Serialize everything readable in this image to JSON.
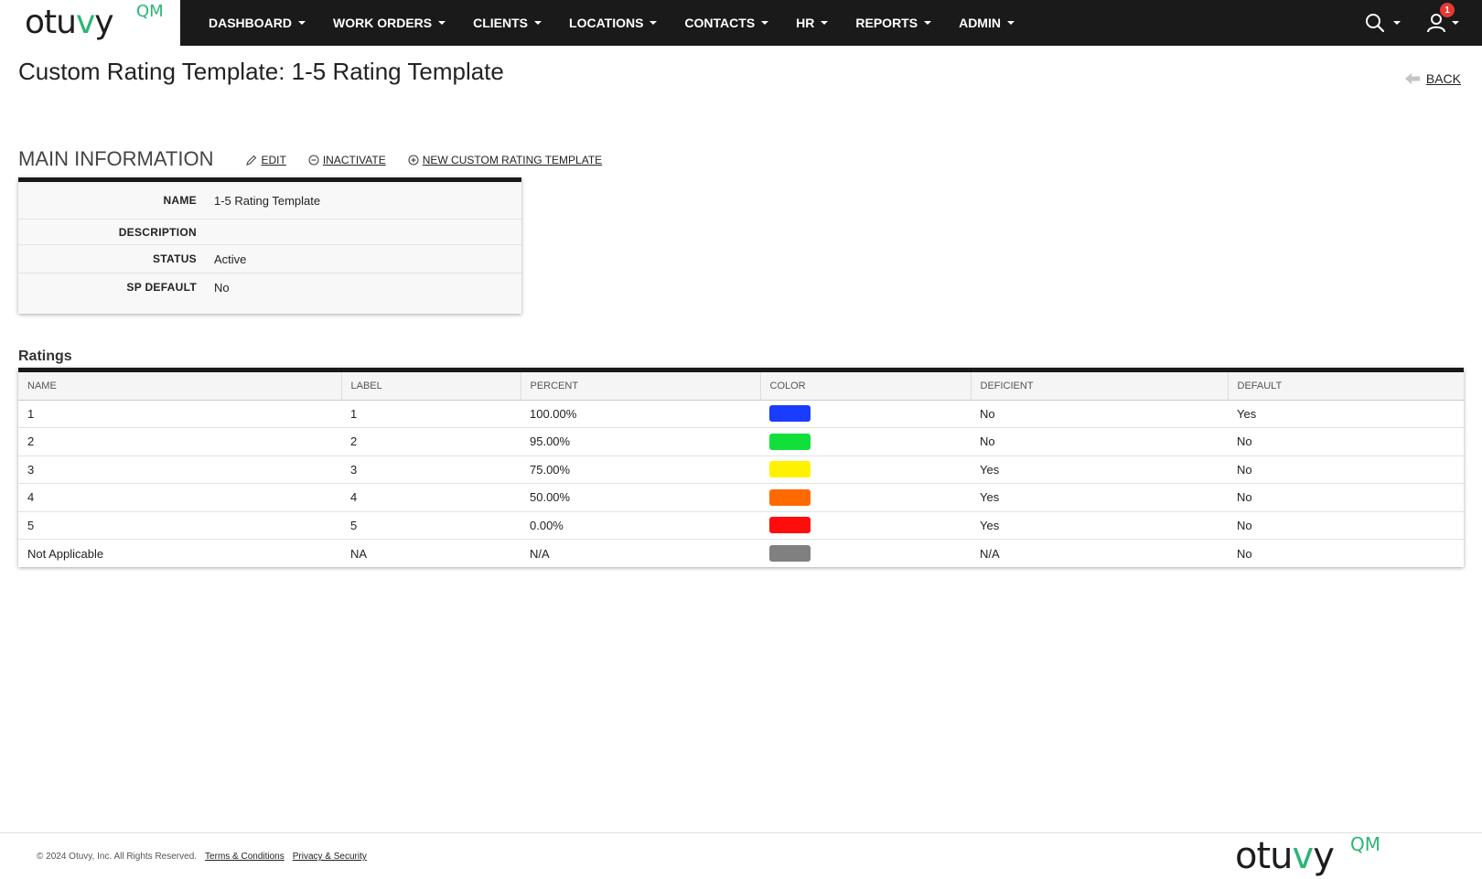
{
  "brand": {
    "logo_main": "otu",
    "logo_v": "v",
    "logo_end": "y",
    "logo_qm": "QM",
    "accent": "#2bb673"
  },
  "nav": {
    "items": [
      {
        "label": "DASHBOARD"
      },
      {
        "label": "WORK ORDERS"
      },
      {
        "label": "CLIENTS"
      },
      {
        "label": "LOCATIONS"
      },
      {
        "label": "CONTACTS"
      },
      {
        "label": "HR"
      },
      {
        "label": "REPORTS"
      },
      {
        "label": "ADMIN"
      }
    ],
    "notification_count": "1",
    "icons": [
      "search-icon",
      "user-icon"
    ]
  },
  "page": {
    "title": "Custom Rating Template: 1-5 Rating Template",
    "back_label": "BACK"
  },
  "main_info": {
    "title": "MAIN INFORMATION",
    "actions": {
      "edit": "EDIT",
      "inactivate": "INACTIVATE",
      "new": "NEW CUSTOM RATING TEMPLATE"
    },
    "fields": [
      {
        "label": "NAME",
        "value": "1-5 Rating Template"
      },
      {
        "label": "DESCRIPTION",
        "value": ""
      },
      {
        "label": "STATUS",
        "value": "Active"
      },
      {
        "label": "SP DEFAULT",
        "value": "No"
      }
    ]
  },
  "ratings": {
    "title": "Ratings",
    "columns": [
      "NAME",
      "LABEL",
      "PERCENT",
      "COLOR",
      "DEFICIENT",
      "DEFAULT"
    ],
    "rows": [
      {
        "name": "1",
        "label": "1",
        "percent": "100.00%",
        "color": "#1a3cff",
        "deficient": "No",
        "default": "Yes"
      },
      {
        "name": "2",
        "label": "2",
        "percent": "95.00%",
        "color": "#11e03a",
        "deficient": "No",
        "default": "No"
      },
      {
        "name": "3",
        "label": "3",
        "percent": "75.00%",
        "color": "#fff200",
        "deficient": "Yes",
        "default": "No"
      },
      {
        "name": "4",
        "label": "4",
        "percent": "50.00%",
        "color": "#ff6a00",
        "deficient": "Yes",
        "default": "No"
      },
      {
        "name": "5",
        "label": "5",
        "percent": "0.00%",
        "color": "#ff0d0d",
        "deficient": "Yes",
        "default": "No"
      },
      {
        "name": "Not Applicable",
        "label": "NA",
        "percent": "N/A",
        "color": "#808080",
        "deficient": "N/A",
        "default": "No"
      }
    ]
  },
  "footer": {
    "copyright": "© 2024 Otuvy, Inc. All Rights Reserved.",
    "terms": "Terms & Conditions",
    "privacy": "Privacy & Security"
  }
}
